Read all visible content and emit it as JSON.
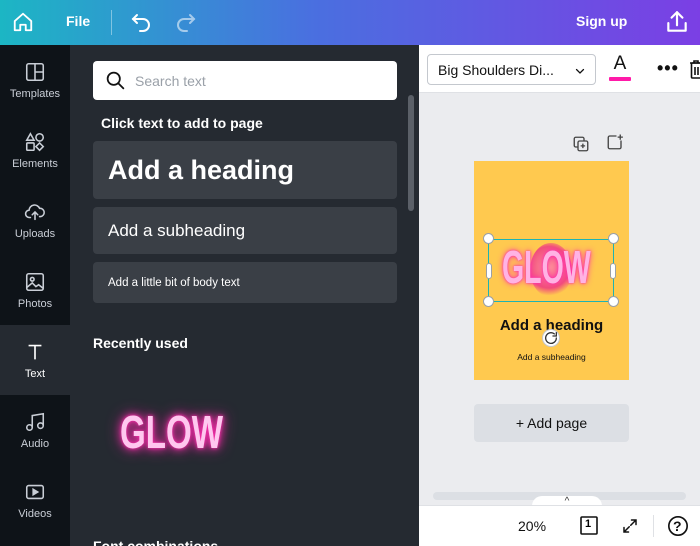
{
  "topbar": {
    "file_label": "File",
    "signup_label": "Sign up"
  },
  "rail": {
    "items": [
      {
        "label": "Templates",
        "icon": "templates-icon"
      },
      {
        "label": "Elements",
        "icon": "elements-icon"
      },
      {
        "label": "Uploads",
        "icon": "uploads-icon"
      },
      {
        "label": "Photos",
        "icon": "photos-icon"
      },
      {
        "label": "Text",
        "icon": "text-icon"
      },
      {
        "label": "Audio",
        "icon": "audio-icon"
      },
      {
        "label": "Videos",
        "icon": "videos-icon"
      }
    ],
    "active": "Text"
  },
  "panel": {
    "search_placeholder": "Search text",
    "click_hint": "Click text to add to page",
    "heading_option": "Add a heading",
    "subheading_option": "Add a subheading",
    "body_option": "Add a little bit of body text",
    "recently_used_label": "Recently used",
    "recent_item": "GLOW",
    "next_section_label": "Font combinations"
  },
  "editor_toolbar": {
    "font_name": "Big Shoulders Di...",
    "text_color_glyph": "A",
    "text_color": "#ff1aa8"
  },
  "page": {
    "background": "#ffc94f",
    "glow_text": "GLOW",
    "heading_text": "Add a heading",
    "subheading_text": "Add a subheading"
  },
  "add_page_label": "+ Add page",
  "bottombar": {
    "zoom": "20%",
    "page_count": "1",
    "help_glyph": "?"
  }
}
